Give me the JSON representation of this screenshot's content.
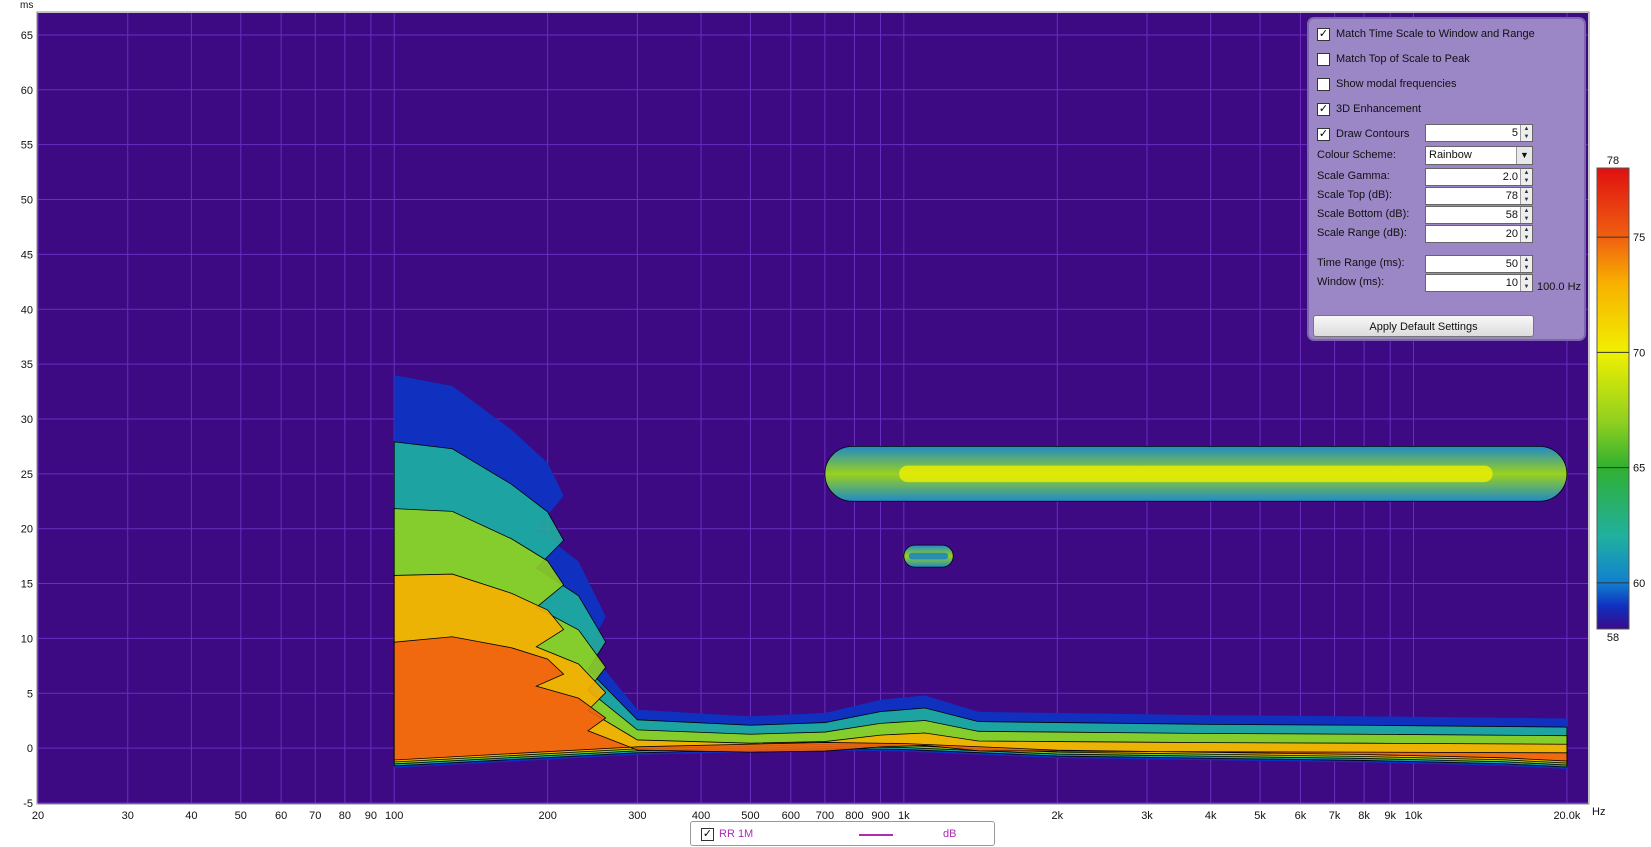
{
  "chart_data": {
    "type": "heatmap",
    "title": "",
    "x_unit": "Hz",
    "y_unit": "ms",
    "xscale": "log",
    "xlim": [
      20,
      22000
    ],
    "ylim": [
      -5,
      67
    ],
    "x_ticks": [
      {
        "v": 20,
        "label": "20"
      },
      {
        "v": 30,
        "label": "30"
      },
      {
        "v": 40,
        "label": "40"
      },
      {
        "v": 50,
        "label": "50"
      },
      {
        "v": 60,
        "label": "60"
      },
      {
        "v": 70,
        "label": "70"
      },
      {
        "v": 80,
        "label": "80"
      },
      {
        "v": 90,
        "label": "90"
      },
      {
        "v": 100,
        "label": "100"
      },
      {
        "v": 200,
        "label": "200"
      },
      {
        "v": 300,
        "label": "300"
      },
      {
        "v": 400,
        "label": "400"
      },
      {
        "v": 500,
        "label": "500"
      },
      {
        "v": 600,
        "label": "600"
      },
      {
        "v": 700,
        "label": "700"
      },
      {
        "v": 800,
        "label": "800"
      },
      {
        "v": 900,
        "label": "900"
      },
      {
        "v": 1000,
        "label": "1k"
      },
      {
        "v": 2000,
        "label": "2k"
      },
      {
        "v": 3000,
        "label": "3k"
      },
      {
        "v": 4000,
        "label": "4k"
      },
      {
        "v": 5000,
        "label": "5k"
      },
      {
        "v": 6000,
        "label": "6k"
      },
      {
        "v": 7000,
        "label": "7k"
      },
      {
        "v": 8000,
        "label": "8k"
      },
      {
        "v": 9000,
        "label": "9k"
      },
      {
        "v": 10000,
        "label": "10k"
      },
      {
        "v": 20000,
        "label": "20.0k"
      }
    ],
    "y_ticks": [
      {
        "v": 65,
        "label": "65"
      },
      {
        "v": 60,
        "label": "60"
      },
      {
        "v": 55,
        "label": "55"
      },
      {
        "v": 50,
        "label": "50"
      },
      {
        "v": 45,
        "label": "45"
      },
      {
        "v": 40,
        "label": "40"
      },
      {
        "v": 35,
        "label": "35"
      },
      {
        "v": 30,
        "label": "30"
      },
      {
        "v": 25,
        "label": "25"
      },
      {
        "v": 20,
        "label": "20"
      },
      {
        "v": 15,
        "label": "15"
      },
      {
        "v": 10,
        "label": "10"
      },
      {
        "v": 5,
        "label": "5"
      },
      {
        "v": 0,
        "label": "0"
      },
      {
        "v": -5,
        "label": "-5"
      }
    ],
    "colorbar": {
      "min": 58,
      "max": 78,
      "ticks": [
        {
          "v": 78,
          "label": "78"
        },
        {
          "v": 75,
          "label": "75"
        },
        {
          "v": 70,
          "label": "70"
        },
        {
          "v": 65,
          "label": "65"
        },
        {
          "v": 60,
          "label": "60"
        },
        {
          "v": 58,
          "label": "58"
        }
      ],
      "stops": [
        {
          "v": 58,
          "c": "#3a0a8a"
        },
        {
          "v": 59,
          "c": "#1030c0"
        },
        {
          "v": 60,
          "c": "#1080d0"
        },
        {
          "v": 62,
          "c": "#20b0a0"
        },
        {
          "v": 65,
          "c": "#30b030"
        },
        {
          "v": 67,
          "c": "#90d020"
        },
        {
          "v": 70,
          "c": "#f0f000"
        },
        {
          "v": 73,
          "c": "#f8b000"
        },
        {
          "v": 75,
          "c": "#f06010"
        },
        {
          "v": 78,
          "c": "#e01010"
        }
      ]
    },
    "background_color": "#3d0a84",
    "grid": true,
    "grid_color": "#6a2ec0",
    "regions": [
      {
        "band": [
          [
            100,
            -1.8
          ],
          [
            300,
            -0.6
          ],
          [
            700,
            -0.2
          ],
          [
            1000,
            -0.3
          ],
          [
            2000,
            -0.9
          ],
          [
            4000,
            -1.1
          ],
          [
            8000,
            -1.3
          ],
          [
            15000,
            -1.6
          ],
          [
            20000,
            -1.9
          ]
        ],
        "top": [
          [
            100,
            34
          ],
          [
            130,
            33
          ],
          [
            170,
            29
          ],
          [
            200,
            26
          ],
          [
            215,
            23
          ],
          [
            190,
            20
          ],
          [
            230,
            17
          ],
          [
            260,
            12
          ],
          [
            240,
            9
          ],
          [
            300,
            3.5
          ],
          [
            500,
            2.9
          ],
          [
            700,
            3.2
          ],
          [
            900,
            4.4
          ],
          [
            1100,
            4.8
          ],
          [
            1400,
            3.3
          ],
          [
            2000,
            3.2
          ],
          [
            4000,
            3
          ],
          [
            8000,
            2.9
          ],
          [
            20000,
            2.7
          ]
        ],
        "levels": [
          59,
          62,
          66,
          71,
          75
        ]
      }
    ],
    "islands": [
      {
        "xlim": [
          700,
          20000
        ],
        "ylim": [
          22.5,
          27.5
        ],
        "peak": 68
      },
      {
        "xlim": [
          1000,
          1250
        ],
        "ylim": [
          16.5,
          18.5
        ],
        "peak": 60
      }
    ],
    "legend": {
      "name": "RR 1M",
      "unit": "dB",
      "checked": true,
      "color": "#b02cb0"
    }
  },
  "controls": {
    "match_time_scale": {
      "label": "Match Time Scale to Window and Range",
      "checked": true
    },
    "match_top": {
      "label": "Match Top of Scale to Peak",
      "checked": false
    },
    "show_modal": {
      "label": "Show modal frequencies",
      "checked": false
    },
    "enhancement_3d": {
      "label": "3D Enhancement",
      "checked": true
    },
    "draw_contours": {
      "label": "Draw Contours",
      "checked": true,
      "value": "5"
    },
    "colour_scheme": {
      "label": "Colour Scheme:",
      "value": "Rainbow"
    },
    "scale_gamma": {
      "label": "Scale Gamma:",
      "value": "2.0"
    },
    "scale_top": {
      "label": "Scale Top (dB):",
      "value": "78"
    },
    "scale_bottom": {
      "label": "Scale Bottom (dB):",
      "value": "58"
    },
    "scale_range": {
      "label": "Scale Range (dB):",
      "value": "20"
    },
    "time_range": {
      "label": "Time Range (ms):",
      "value": "50"
    },
    "window": {
      "label": "Window (ms):",
      "value": "10",
      "note": "100.0 Hz"
    },
    "apply_button": "Apply Default Settings"
  },
  "check_mark": "✓"
}
